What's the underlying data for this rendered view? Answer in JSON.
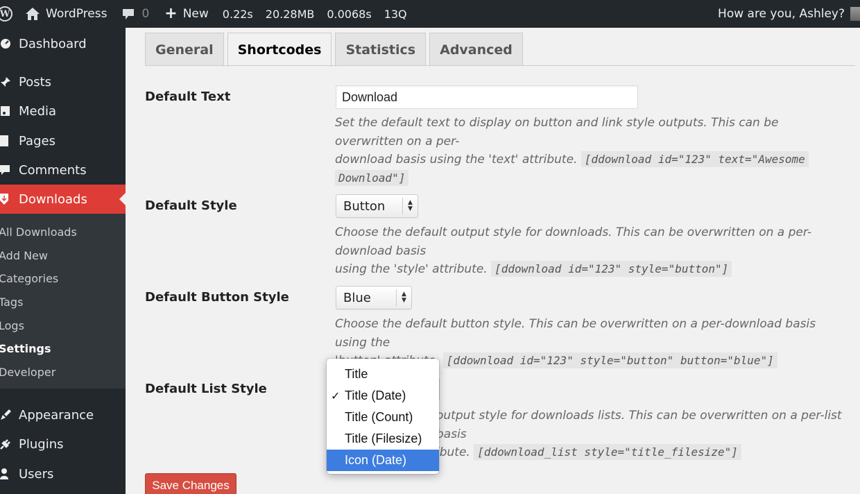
{
  "adminbar": {
    "site": "WordPress",
    "comments_count": "0",
    "new_label": "New",
    "stats": [
      "0.22s",
      "20.28MB",
      "0.0068s",
      "13Q"
    ],
    "greeting": "How are you, Ashley?"
  },
  "sidebar": {
    "items": [
      {
        "label": "Dashboard",
        "icon": "dashboard-icon"
      },
      {
        "label": "Posts",
        "icon": "pin-icon"
      },
      {
        "label": "Media",
        "icon": "media-icon"
      },
      {
        "label": "Pages",
        "icon": "pages-icon"
      },
      {
        "label": "Comments",
        "icon": "comment-icon"
      },
      {
        "label": "Downloads",
        "icon": "download-icon"
      },
      {
        "label": "Appearance",
        "icon": "brush-icon"
      },
      {
        "label": "Plugins",
        "icon": "plug-icon"
      },
      {
        "label": "Users",
        "icon": "user-icon"
      }
    ],
    "submenu": [
      "All Downloads",
      "Add New",
      "Categories",
      "Tags",
      "Logs",
      "Settings",
      "Developer"
    ]
  },
  "tabs": [
    "General",
    "Shortcodes",
    "Statistics",
    "Advanced"
  ],
  "fields": {
    "default_text": {
      "label": "Default Text",
      "value": "Download",
      "desc_line1": "Set the default text to display on button and link style outputs. This can be overwritten on a per-",
      "desc_line2": "download basis using the 'text' attribute.",
      "code_a": "[ddownload id=\"123\" text=\"Awesome",
      "code_b": "Download\"]"
    },
    "default_style": {
      "label": "Default Style",
      "value": "Button",
      "desc_line1": "Choose the default output style for downloads. This can be overwritten on a per-download basis",
      "desc_line2": "using the 'style' attribute.",
      "code": "[ddownload id=\"123\" style=\"button\"]"
    },
    "default_button_style": {
      "label": "Default Button Style",
      "value": "Blue",
      "desc_line1": "Choose the default button style. This can be overwritten on a per-download basis using the",
      "desc_line2": "'button' attribute.",
      "code": "[ddownload id=\"123\" style=\"button\" button=\"blue\"]"
    },
    "default_list_style": {
      "label": "Default List Style",
      "desc_line1": "output style for downloads lists. This can be overwritten on a per-list basis",
      "desc_line2": "ibute.",
      "code": "[ddownload_list style=\"title_filesize\"]",
      "options": [
        "Title",
        "Title (Date)",
        "Title (Count)",
        "Title (Filesize)",
        "Icon (Date)"
      ],
      "checked": "Title (Date)",
      "highlighted": "Icon (Date)"
    }
  },
  "save_label": "Save Changes",
  "colors": {
    "accent": "#dd3d36",
    "highlight": "#3d7de0",
    "adminbar": "#23282d"
  }
}
